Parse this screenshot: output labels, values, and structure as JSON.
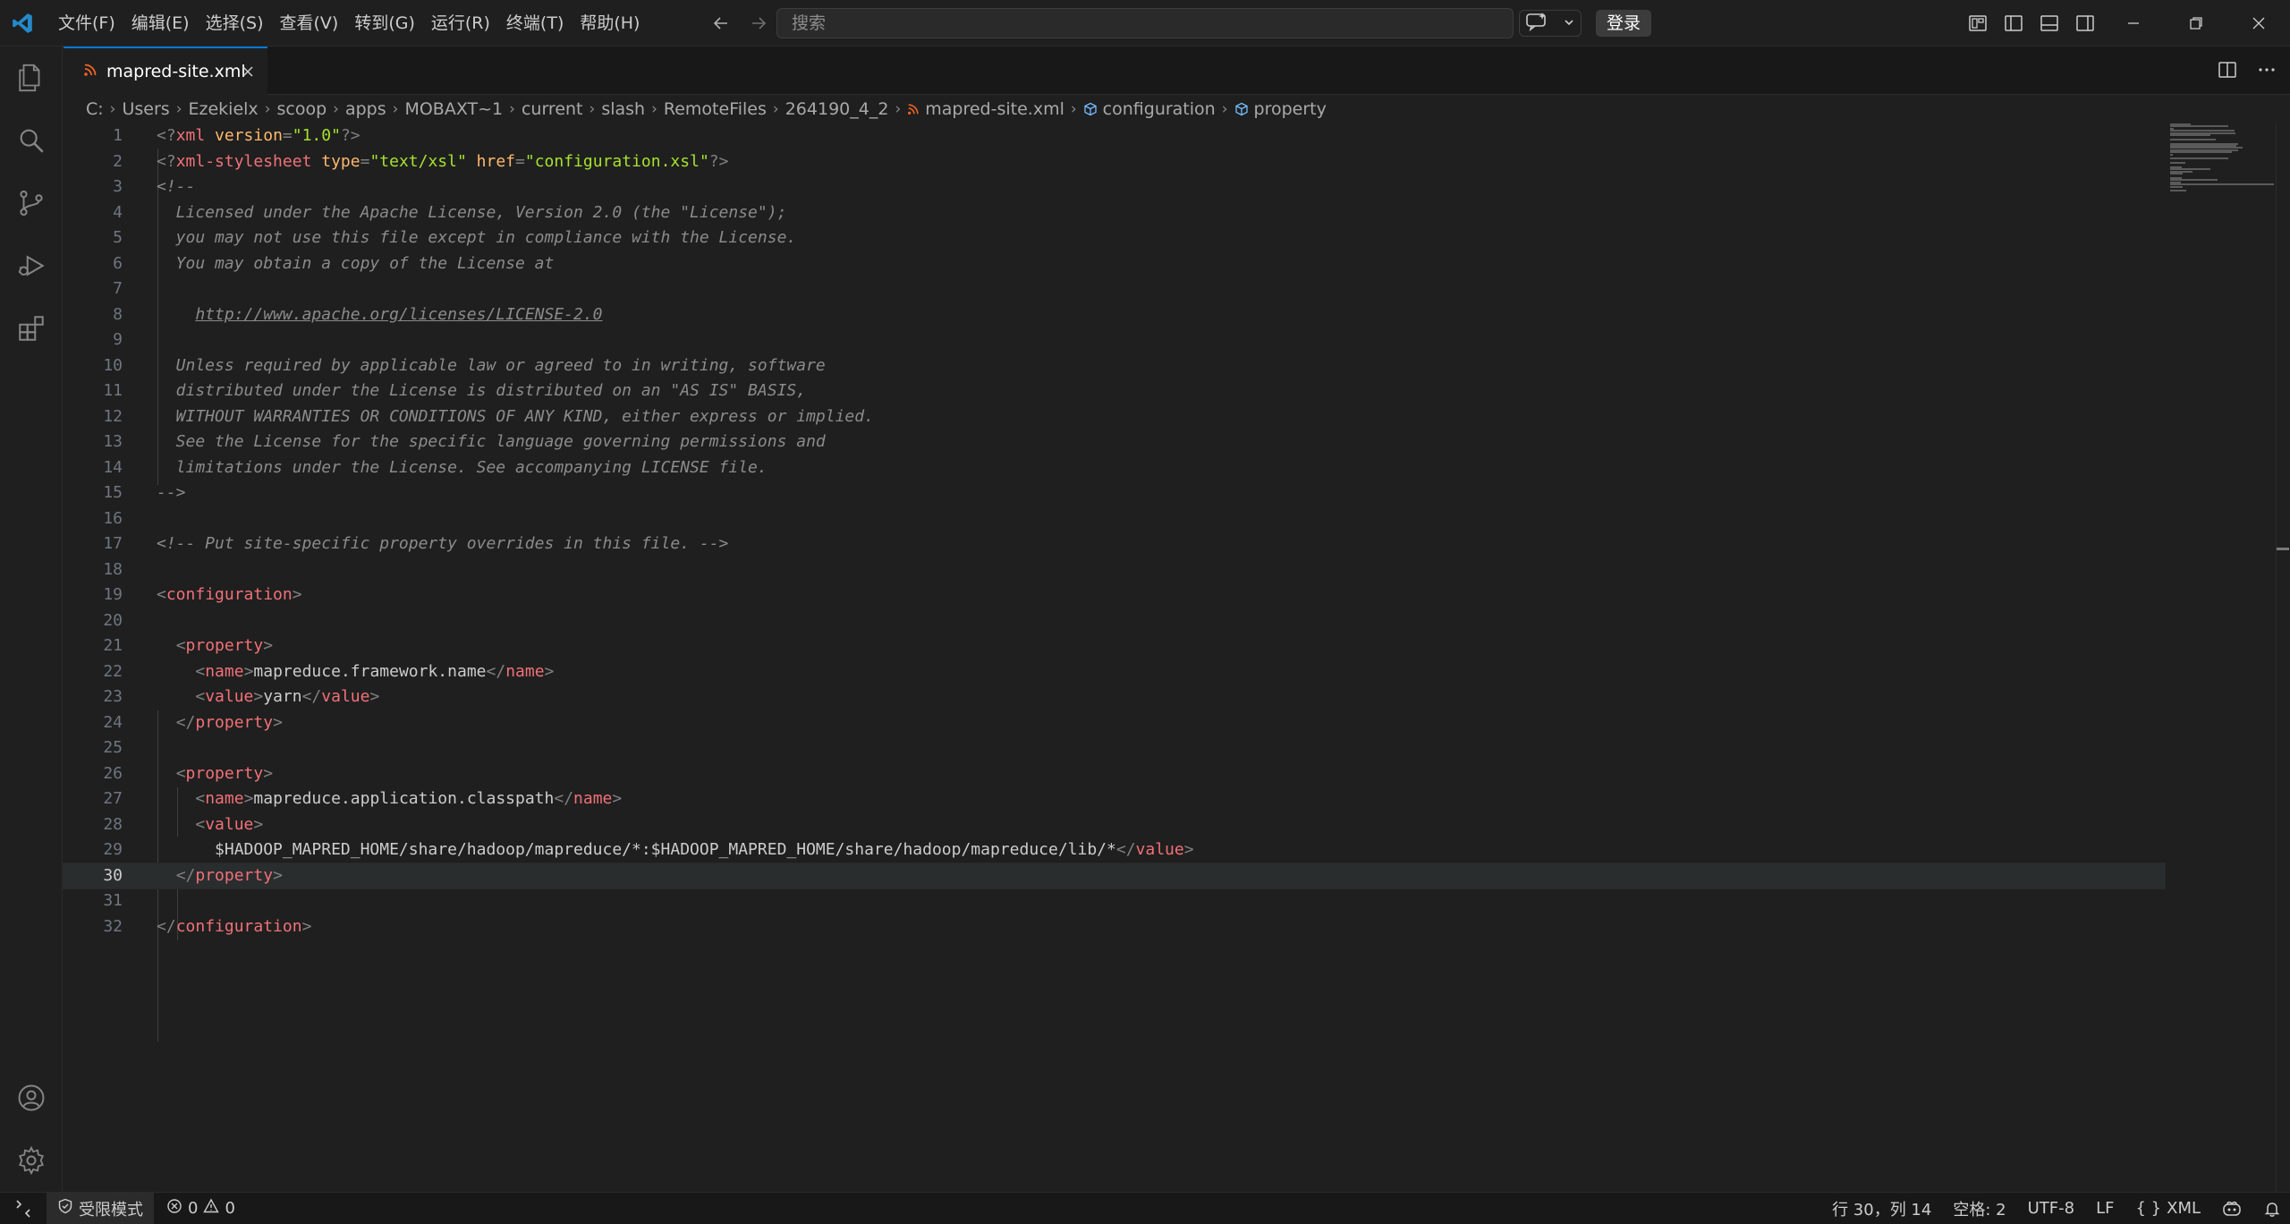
{
  "titlebar": {
    "menus": [
      "文件(F)",
      "编辑(E)",
      "选择(S)",
      "查看(V)",
      "转到(G)",
      "运行(R)",
      "终端(T)",
      "帮助(H)"
    ],
    "search_placeholder": "搜索",
    "login_label": "登录"
  },
  "tab": {
    "label": "mapred-site.xml"
  },
  "breadcrumb": {
    "path": [
      "C:",
      "Users",
      "Ezekielx",
      "scoop",
      "apps",
      "MOBAXT~1",
      "current",
      "slash",
      "RemoteFiles",
      "264190_4_2"
    ],
    "file": "mapred-site.xml",
    "symbols": [
      "configuration",
      "property"
    ]
  },
  "editor": {
    "current_line": 30,
    "lines": [
      {
        "n": "1",
        "tokens": [
          [
            "brk",
            "<?"
          ],
          [
            "tag",
            "xml"
          ],
          [
            "txt",
            " "
          ],
          [
            "attr",
            "version"
          ],
          [
            "brk",
            "="
          ],
          [
            "str",
            "\"1.0\""
          ],
          [
            "brk",
            "?>"
          ]
        ]
      },
      {
        "n": "2",
        "tokens": [
          [
            "brk",
            "<?"
          ],
          [
            "tag",
            "xml-stylesheet"
          ],
          [
            "txt",
            " "
          ],
          [
            "attr",
            "type"
          ],
          [
            "brk",
            "="
          ],
          [
            "str",
            "\"text/xsl\""
          ],
          [
            "txt",
            " "
          ],
          [
            "attr",
            "href"
          ],
          [
            "brk",
            "="
          ],
          [
            "str",
            "\"configuration.xsl\""
          ],
          [
            "brk",
            "?>"
          ]
        ]
      },
      {
        "n": "3",
        "tokens": [
          [
            "cmt",
            "<!--"
          ]
        ]
      },
      {
        "n": "4",
        "tokens": [
          [
            "cmt",
            "  Licensed under the Apache License, Version 2.0 (the \"License\");"
          ]
        ]
      },
      {
        "n": "5",
        "tokens": [
          [
            "cmt",
            "  you may not use this file except in compliance with the License."
          ]
        ]
      },
      {
        "n": "6",
        "tokens": [
          [
            "cmt",
            "  You may obtain a copy of the License at"
          ]
        ]
      },
      {
        "n": "7",
        "tokens": []
      },
      {
        "n": "8",
        "tokens": [
          [
            "cmt",
            "    "
          ],
          [
            "link",
            "http://www.apache.org/licenses/LICENSE-2.0"
          ]
        ]
      },
      {
        "n": "9",
        "tokens": []
      },
      {
        "n": "10",
        "tokens": [
          [
            "cmt",
            "  Unless required by applicable law or agreed to in writing, software"
          ]
        ]
      },
      {
        "n": "11",
        "tokens": [
          [
            "cmt",
            "  distributed under the License is distributed on an \"AS IS\" BASIS,"
          ]
        ]
      },
      {
        "n": "12",
        "tokens": [
          [
            "cmt",
            "  WITHOUT WARRANTIES OR CONDITIONS OF ANY KIND, either express or implied."
          ]
        ]
      },
      {
        "n": "13",
        "tokens": [
          [
            "cmt",
            "  See the License for the specific language governing permissions and"
          ]
        ]
      },
      {
        "n": "14",
        "tokens": [
          [
            "cmt",
            "  limitations under the License. See accompanying LICENSE file."
          ]
        ]
      },
      {
        "n": "15",
        "tokens": [
          [
            "cmt",
            "-->"
          ]
        ]
      },
      {
        "n": "16",
        "tokens": []
      },
      {
        "n": "17",
        "tokens": [
          [
            "cmt",
            "<!-- Put site-specific property overrides in this file. -->"
          ]
        ]
      },
      {
        "n": "18",
        "tokens": []
      },
      {
        "n": "19",
        "tokens": [
          [
            "brk",
            "<"
          ],
          [
            "tag",
            "configuration"
          ],
          [
            "brk",
            ">"
          ]
        ]
      },
      {
        "n": "20",
        "tokens": []
      },
      {
        "n": "21",
        "tokens": [
          [
            "txt",
            "  "
          ],
          [
            "brk",
            "<"
          ],
          [
            "tag",
            "property"
          ],
          [
            "brk",
            ">"
          ]
        ]
      },
      {
        "n": "22",
        "tokens": [
          [
            "txt",
            "    "
          ],
          [
            "brk",
            "<"
          ],
          [
            "tag",
            "name"
          ],
          [
            "brk",
            ">"
          ],
          [
            "txt",
            "mapreduce.framework.name"
          ],
          [
            "brk",
            "</"
          ],
          [
            "tag",
            "name"
          ],
          [
            "brk",
            ">"
          ]
        ]
      },
      {
        "n": "23",
        "tokens": [
          [
            "txt",
            "    "
          ],
          [
            "brk",
            "<"
          ],
          [
            "tag",
            "value"
          ],
          [
            "brk",
            ">"
          ],
          [
            "txt",
            "yarn"
          ],
          [
            "brk",
            "</"
          ],
          [
            "tag",
            "value"
          ],
          [
            "brk",
            ">"
          ]
        ]
      },
      {
        "n": "24",
        "tokens": [
          [
            "txt",
            "  "
          ],
          [
            "brk",
            "</"
          ],
          [
            "tag",
            "property"
          ],
          [
            "brk",
            ">"
          ]
        ]
      },
      {
        "n": "25",
        "tokens": []
      },
      {
        "n": "26",
        "tokens": [
          [
            "txt",
            "  "
          ],
          [
            "brk",
            "<"
          ],
          [
            "tag",
            "property"
          ],
          [
            "brk",
            ">"
          ]
        ]
      },
      {
        "n": "27",
        "tokens": [
          [
            "txt",
            "    "
          ],
          [
            "brk",
            "<"
          ],
          [
            "tag",
            "name"
          ],
          [
            "brk",
            ">"
          ],
          [
            "txt",
            "mapreduce.application.classpath"
          ],
          [
            "brk",
            "</"
          ],
          [
            "tag",
            "name"
          ],
          [
            "brk",
            ">"
          ]
        ]
      },
      {
        "n": "28",
        "tokens": [
          [
            "txt",
            "    "
          ],
          [
            "brk",
            "<"
          ],
          [
            "tag",
            "value"
          ],
          [
            "brk",
            ">"
          ]
        ]
      },
      {
        "n": "29",
        "tokens": [
          [
            "txt",
            "      $HADOOP_MAPRED_HOME/share/hadoop/mapreduce/*:$HADOOP_MAPRED_HOME/share/hadoop/mapreduce/lib/*"
          ],
          [
            "brk",
            "</"
          ],
          [
            "tag",
            "value"
          ],
          [
            "brk",
            ">"
          ]
        ]
      },
      {
        "n": "30",
        "tokens": [
          [
            "txt",
            "  "
          ],
          [
            "brk",
            "</"
          ],
          [
            "tag",
            "property"
          ],
          [
            "brk",
            ">"
          ]
        ]
      },
      {
        "n": "31",
        "tokens": []
      },
      {
        "n": "32",
        "tokens": [
          [
            "brk",
            "</"
          ],
          [
            "tag",
            "configuration"
          ],
          [
            "brk",
            ">"
          ]
        ]
      }
    ]
  },
  "statusbar": {
    "restricted_mode": "受限模式",
    "errors": "0",
    "warnings": "0",
    "cursor": "行 30，列 14",
    "spaces": "空格: 2",
    "encoding": "UTF-8",
    "eol": "LF",
    "language": "XML"
  },
  "colors": {
    "accent": "#0078d4",
    "tag": "#f07178",
    "attr": "#ffb86c",
    "string": "#a6e22e",
    "comment": "#8b8b8b",
    "xml_file_icon": "#f26522"
  }
}
